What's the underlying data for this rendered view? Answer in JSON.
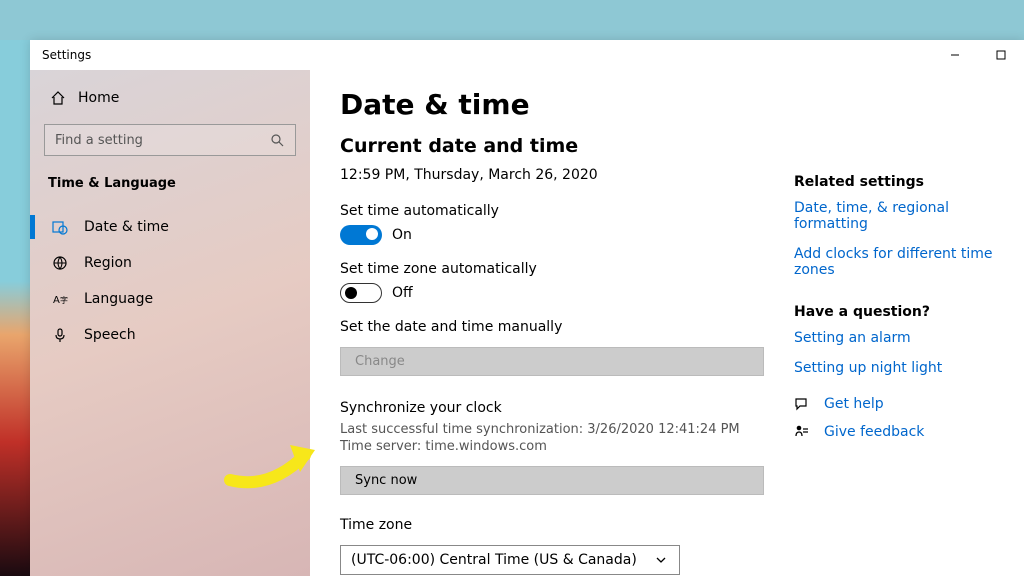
{
  "window": {
    "title": "Settings"
  },
  "sidebar": {
    "home_label": "Home",
    "search_placeholder": "Find a setting",
    "section": "Time & Language",
    "items": [
      {
        "label": "Date & time"
      },
      {
        "label": "Region"
      },
      {
        "label": "Language"
      },
      {
        "label": "Speech"
      }
    ]
  },
  "page": {
    "title": "Date & time",
    "current_heading": "Current date and time",
    "current_datetime": "12:59 PM, Thursday, March 26, 2020",
    "set_time_auto_label": "Set time automatically",
    "set_time_auto_state": "On",
    "set_tz_auto_label": "Set time zone automatically",
    "set_tz_auto_state": "Off",
    "manual_label": "Set the date and time manually",
    "change_button": "Change",
    "sync_heading": "Synchronize your clock",
    "sync_last": "Last successful time synchronization: 3/26/2020 12:41:24 PM",
    "sync_server": "Time server: time.windows.com",
    "sync_button": "Sync now",
    "tz_label": "Time zone",
    "tz_value": "(UTC-06:00) Central Time (US & Canada)"
  },
  "aside": {
    "related_heading": "Related settings",
    "link_regional": "Date, time, & regional formatting",
    "link_clocks": "Add clocks for different time zones",
    "question_heading": "Have a question?",
    "link_alarm": "Setting an alarm",
    "link_nightlight": "Setting up night light",
    "get_help": "Get help",
    "give_feedback": "Give feedback"
  }
}
